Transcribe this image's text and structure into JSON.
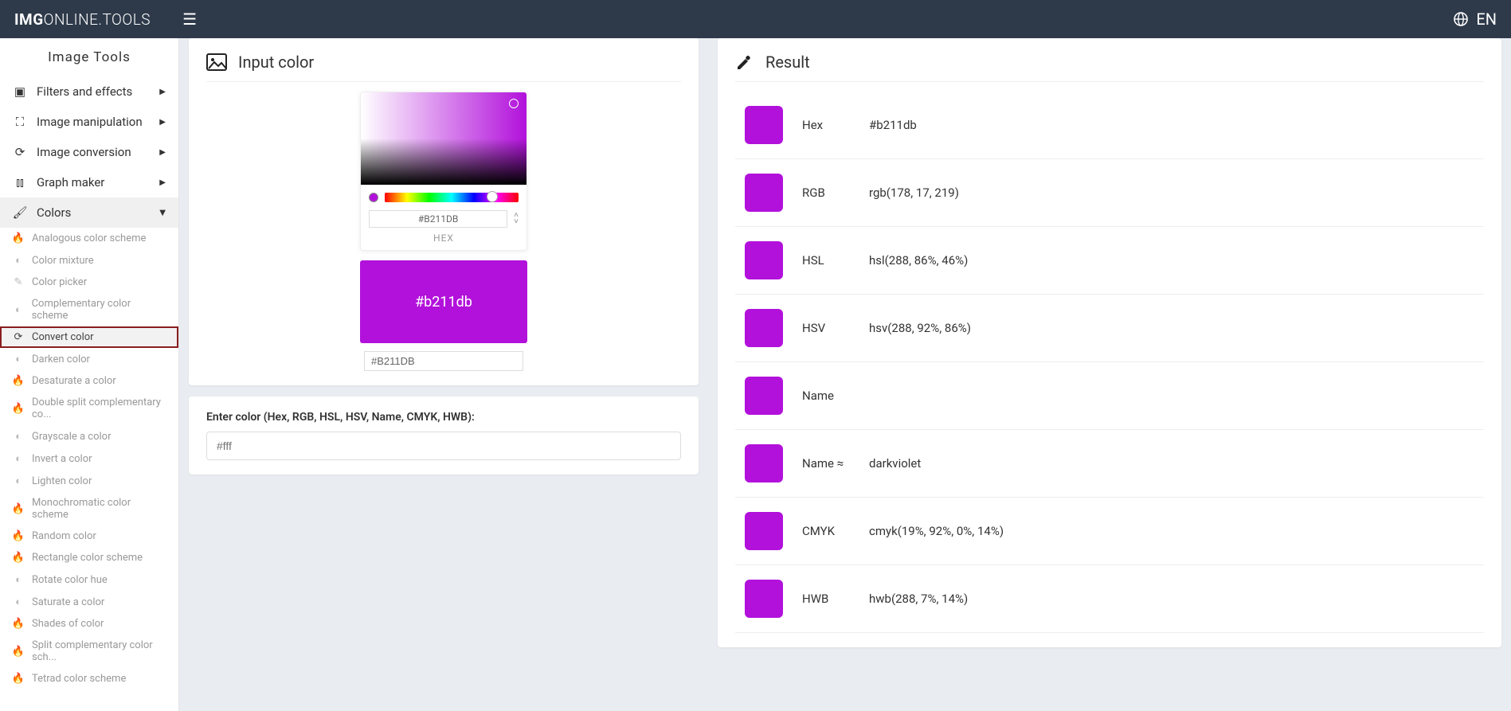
{
  "brand": {
    "strong": "IMG",
    "mid": "ONLINE",
    "end": ".TOOLS"
  },
  "lang": "EN",
  "sidebar": {
    "title": "Image Tools",
    "parents": [
      {
        "label": "Filters and effects"
      },
      {
        "label": "Image manipulation"
      },
      {
        "label": "Image conversion"
      },
      {
        "label": "Graph maker"
      },
      {
        "label": "Colors"
      }
    ],
    "colors_children": [
      "Analogous color scheme",
      "Color mixture",
      "Color picker",
      "Complementary color scheme",
      "Convert color",
      "Darken color",
      "Desaturate a color",
      "Double split complementary co...",
      "Grayscale a color",
      "Invert a color",
      "Lighten color",
      "Monochromatic color scheme",
      "Random color",
      "Rectangle color scheme",
      "Rotate color hue",
      "Saturate a color",
      "Shades of color",
      "Split complementary color sch...",
      "Tetrad color scheme"
    ],
    "active_child_index": 4
  },
  "input_card": {
    "title": "Input color",
    "hex_value": "#B211DB",
    "hex_label": "HEX",
    "swatch_text": "#b211db",
    "field_value": "#B211DB"
  },
  "enter_card": {
    "label": "Enter color (Hex, RGB, HSL, HSV, Name, CMYK, HWB):",
    "placeholder": "#fff"
  },
  "result": {
    "title": "Result",
    "color": "#b211db",
    "rows": [
      {
        "key": "Hex",
        "value": "#b211db"
      },
      {
        "key": "RGB",
        "value": "rgb(178, 17, 219)"
      },
      {
        "key": "HSL",
        "value": "hsl(288, 86%, 46%)"
      },
      {
        "key": "HSV",
        "value": "hsv(288, 92%, 86%)"
      },
      {
        "key": "Name",
        "value": ""
      },
      {
        "key": "Name ≈",
        "value": "darkviolet"
      },
      {
        "key": "CMYK",
        "value": "cmyk(19%, 92%, 0%, 14%)"
      },
      {
        "key": "HWB",
        "value": "hwb(288, 7%, 14%)"
      }
    ]
  }
}
